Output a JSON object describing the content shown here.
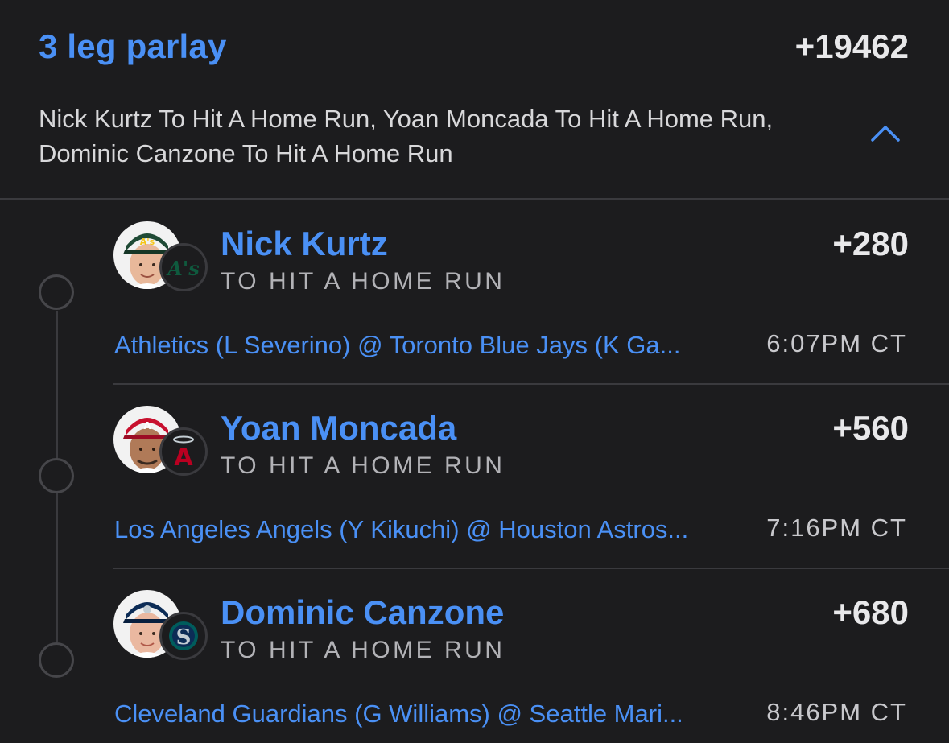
{
  "parlay": {
    "title": "3 leg parlay",
    "odds": "+19462",
    "description": "Nick Kurtz To Hit A Home Run, Yoan Moncada To Hit A Home Run, Dominic Canzone To Hit A Home Run",
    "collapse_icon": "chevron-up-icon"
  },
  "legs": [
    {
      "player": "Nick Kurtz",
      "odds": "+280",
      "market": "TO HIT A HOME RUN",
      "matchup": "Athletics (L Severino) @ Toronto Blue Jays (K Ga...",
      "time": "6:07PM CT",
      "team_logo_text": "A's",
      "team_color": "#0f5a3e",
      "cap_color": "#1f4a35"
    },
    {
      "player": "Yoan Moncada",
      "odds": "+560",
      "market": "TO HIT A HOME RUN",
      "matchup": "Los Angeles Angels (Y Kikuchi) @ Houston Astros...",
      "time": "7:16PM CT",
      "team_logo_text": "A",
      "team_color": "#ba0021",
      "cap_color": "#c8102e"
    },
    {
      "player": "Dominic Canzone",
      "odds": "+680",
      "market": "TO HIT A HOME RUN",
      "matchup": "Cleveland Guardians (G Williams) @ Seattle Mari...",
      "time": "8:46PM CT",
      "team_logo_text": "S",
      "team_color": "#005c5c",
      "cap_color": "#0c2c56"
    }
  ]
}
